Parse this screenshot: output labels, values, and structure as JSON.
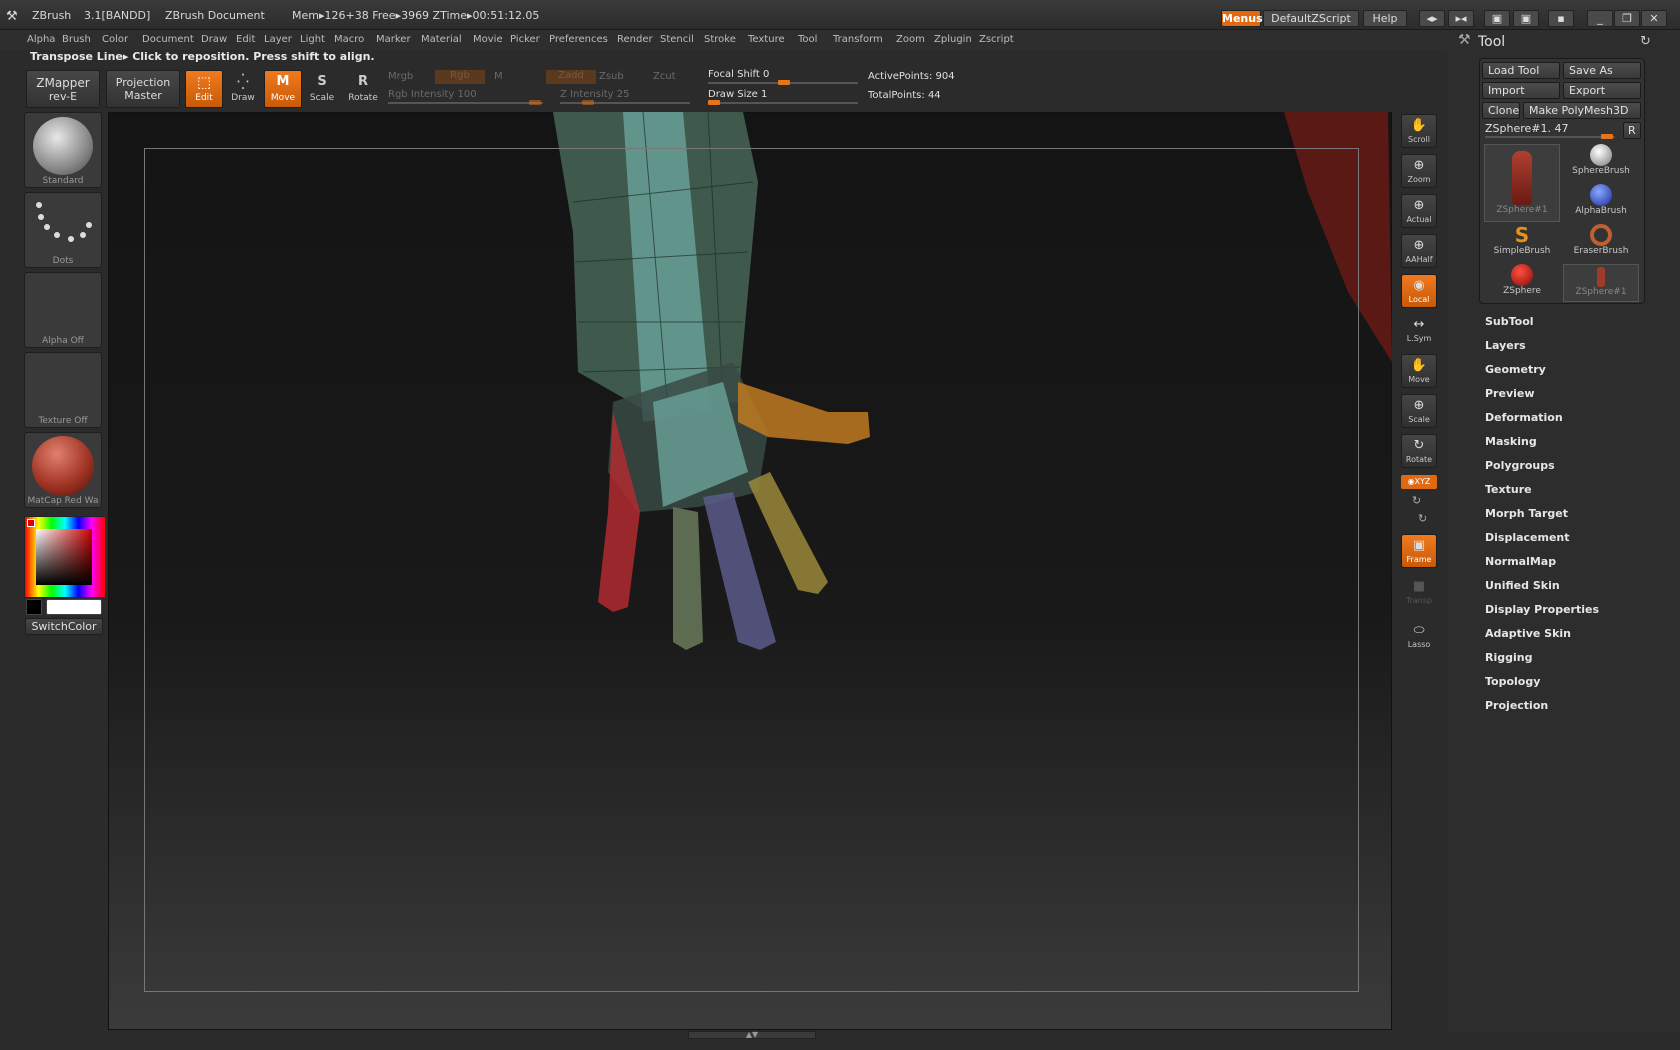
{
  "titlebar": {
    "app": "ZBrush",
    "version": "3.1[BANDD]",
    "document": "ZBrush Document",
    "mem": "Mem▸126+38 Free▸3969 ZTime▸00:51:12.05",
    "menus_btn": "Menus",
    "script_btn": "DefaultZScript",
    "help_btn": "Help"
  },
  "menubar": [
    "Alpha",
    "Brush",
    "Color",
    "Document",
    "Draw",
    "Edit",
    "Layer",
    "Light",
    "Macro",
    "Marker",
    "Material",
    "Movie",
    "Picker",
    "Preferences",
    "Render",
    "Stencil",
    "Stroke",
    "Texture",
    "Tool",
    "Transform",
    "Zoom",
    "Zplugin",
    "Zscript"
  ],
  "hint": "Transpose Line▸ Click to reposition. Press shift to align.",
  "shelf": {
    "zmapper": "ZMapper",
    "zmapper_sub": "rev-E",
    "projection": "Projection",
    "projection_sub": "Master",
    "edit": "Edit",
    "draw": "Draw",
    "move": "Move",
    "scale": "Scale",
    "rotate": "Rotate",
    "mrgb": "Mrgb",
    "rgb": "Rgb",
    "m": "M",
    "zadd": "Zadd",
    "zsub": "Zsub",
    "zcut": "Zcut",
    "rgb_intensity": "Rgb Intensity 100",
    "z_intensity": "Z Intensity 25",
    "focal_shift": "Focal Shift 0",
    "draw_size": "Draw Size 1",
    "active_points": "ActivePoints: 904",
    "total_points": "TotalPoints: 44"
  },
  "left": {
    "brush": "Standard",
    "stroke": "Dots",
    "alpha": "Alpha Off",
    "texture": "Texture Off",
    "material": "MatCap Red Wa",
    "switch_color": "SwitchColor"
  },
  "right": [
    {
      "label": "Scroll",
      "icon": "✋"
    },
    {
      "label": "Zoom",
      "icon": "⊕"
    },
    {
      "label": "Actual",
      "icon": "⊕"
    },
    {
      "label": "AAHalf",
      "icon": "⊕"
    },
    {
      "label": "Local",
      "icon": "◉"
    },
    {
      "label": "L.Sym",
      "icon": "↔"
    },
    {
      "label": "Move",
      "icon": "✋"
    },
    {
      "label": "Scale",
      "icon": "⊕"
    },
    {
      "label": "Rotate",
      "icon": "↻"
    },
    {
      "label": "Frame",
      "icon": "▣"
    },
    {
      "label": "Transp",
      "icon": "■"
    },
    {
      "label": "Lasso",
      "icon": "⬭"
    }
  ],
  "xyz_btn": "◉XYZ",
  "tool": {
    "title": "Tool",
    "load": "Load Tool",
    "save_as": "Save As",
    "import": "Import",
    "export": "Export",
    "clone": "Clone",
    "make_polymesh": "Make PolyMesh3D",
    "current_tool": "ZSphere#1. 47",
    "r_btn": "R",
    "thumbs": [
      "ZSphere#1",
      "SphereBrush",
      "AlphaBrush",
      "SimpleBrush",
      "EraserBrush",
      "ZSphere",
      "ZSphere#1"
    ],
    "subpalettes": [
      "SubTool",
      "Layers",
      "Geometry",
      "Preview",
      "Deformation",
      "Masking",
      "Polygroups",
      "Texture",
      "Morph Target",
      "Displacement",
      "NormalMap",
      "Unified Skin",
      "Display Properties",
      "Adaptive Skin",
      "Rigging",
      "Topology",
      "Projection"
    ]
  },
  "colors": {
    "accent": "#e8721a",
    "background": "#2b2b2b"
  }
}
